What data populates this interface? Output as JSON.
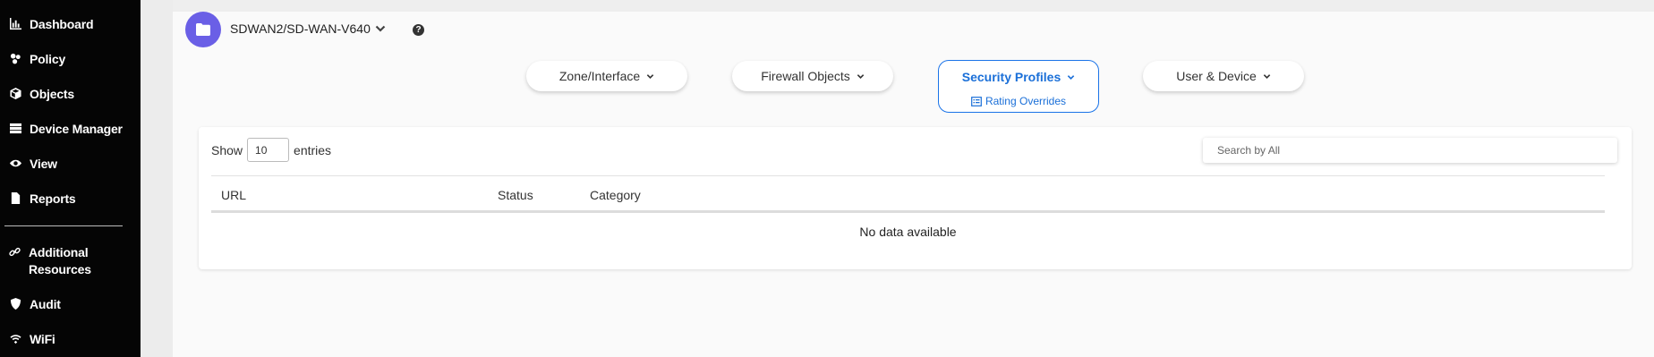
{
  "sidebar": {
    "items": [
      {
        "label": "Dashboard",
        "icon": "chart-bar-icon"
      },
      {
        "label": "Policy",
        "icon": "sitemap-icon"
      },
      {
        "label": "Objects",
        "icon": "cube-icon"
      },
      {
        "label": "Device Manager",
        "icon": "server-icon"
      },
      {
        "label": "View",
        "icon": "eye-icon"
      },
      {
        "label": "Reports",
        "icon": "file-icon"
      },
      {
        "label": "Additional Resources",
        "icon": "link-icon"
      },
      {
        "label": "Audit",
        "icon": "shield-icon"
      },
      {
        "label": "WiFi",
        "icon": "wifi-icon"
      }
    ]
  },
  "header": {
    "device": "SDWAN2/SD-WAN-V640",
    "help": "?"
  },
  "tabs": {
    "zone": "Zone/Interface",
    "firewall": "Firewall Objects",
    "security": "Security Profiles",
    "security_sub": "Rating Overrides",
    "user": "User & Device"
  },
  "table": {
    "show_label": "Show",
    "entries_value": "10",
    "entries_label": "entries",
    "search_placeholder": "Search by All",
    "columns": [
      "URL",
      "Status",
      "Category"
    ],
    "empty_text": "No data available"
  },
  "colors": {
    "sidebar_bg": "#050505",
    "accent": "#1a6fd8",
    "folder_badge": "#6a5fe6"
  }
}
